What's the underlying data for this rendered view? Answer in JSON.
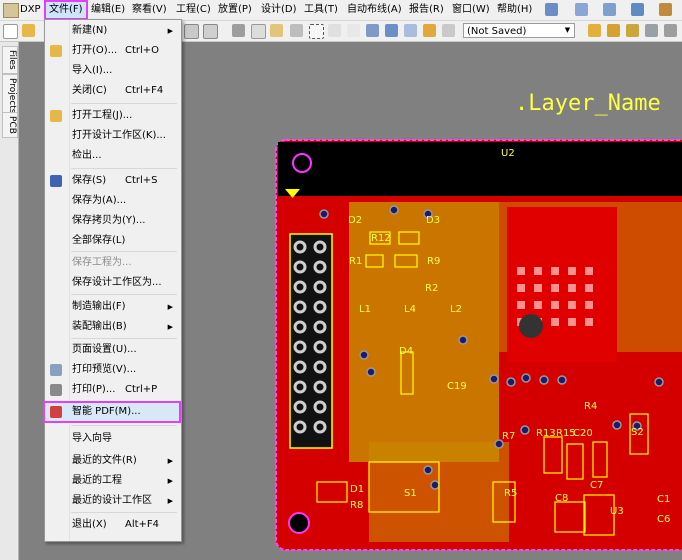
{
  "menubar": {
    "app": "DXP",
    "items": [
      "文件(F)",
      "编辑(E)",
      "察看(V)",
      "工程(C)",
      "放置(P)",
      "设计(D)",
      "工具(T)",
      "自动布线(A)",
      "报告(R)",
      "窗口(W)",
      "帮助(H)"
    ]
  },
  "toolbar": {
    "saved_state": "(Not Saved)"
  },
  "side_tabs": [
    "Files",
    "Projects",
    "PCB"
  ],
  "file_menu": {
    "items": [
      {
        "label": "新建(N)",
        "shortcut": "",
        "submenu": true,
        "disabled": false
      },
      {
        "label": "打开(O)...",
        "shortcut": "Ctrl+O",
        "submenu": false,
        "disabled": false
      },
      {
        "label": "导入(I)...",
        "shortcut": "",
        "submenu": false,
        "disabled": false
      },
      {
        "label": "关闭(C)",
        "shortcut": "Ctrl+F4",
        "submenu": false,
        "disabled": false
      },
      {
        "label": "打开工程(J)...",
        "shortcut": "",
        "submenu": false,
        "disabled": false
      },
      {
        "label": "打开设计工作区(K)...",
        "shortcut": "",
        "submenu": false,
        "disabled": false
      },
      {
        "label": "检出...",
        "shortcut": "",
        "submenu": false,
        "disabled": false
      },
      {
        "label": "保存(S)",
        "shortcut": "Ctrl+S",
        "submenu": false,
        "disabled": false
      },
      {
        "label": "保存为(A)...",
        "shortcut": "",
        "submenu": false,
        "disabled": false
      },
      {
        "label": "保存拷贝为(Y)...",
        "shortcut": "",
        "submenu": false,
        "disabled": false
      },
      {
        "label": "全部保存(L)",
        "shortcut": "",
        "submenu": false,
        "disabled": false
      },
      {
        "label": "保存工程为...",
        "shortcut": "",
        "submenu": false,
        "disabled": true
      },
      {
        "label": "保存设计工作区为...",
        "shortcut": "",
        "submenu": false,
        "disabled": false
      },
      {
        "label": "制造输出(F)",
        "shortcut": "",
        "submenu": true,
        "disabled": false
      },
      {
        "label": "装配输出(B)",
        "shortcut": "",
        "submenu": true,
        "disabled": false
      },
      {
        "label": "页面设置(U)...",
        "shortcut": "",
        "submenu": false,
        "disabled": false
      },
      {
        "label": "打印预览(V)...",
        "shortcut": "",
        "submenu": false,
        "disabled": false
      },
      {
        "label": "打印(P)...",
        "shortcut": "Ctrl+P",
        "submenu": false,
        "disabled": false
      },
      {
        "label": "智能 PDF(M)...",
        "shortcut": "",
        "submenu": false,
        "disabled": false
      },
      {
        "label": "导入向导",
        "shortcut": "",
        "submenu": false,
        "disabled": false
      },
      {
        "label": "最近的文件(R)",
        "shortcut": "",
        "submenu": true,
        "disabled": false
      },
      {
        "label": "最近的工程",
        "shortcut": "",
        "submenu": true,
        "disabled": false
      },
      {
        "label": "最近的设计工作区",
        "shortcut": "",
        "submenu": true,
        "disabled": false
      },
      {
        "label": "退出(X)",
        "shortcut": "Alt+F4",
        "submenu": false,
        "disabled": false
      }
    ]
  },
  "pcb": {
    "layer_name": ".Layer_Name",
    "designators": [
      "U2",
      "D2",
      "D3",
      "R12",
      "R1",
      "R9",
      "R2",
      "L1",
      "L4",
      "L2",
      "C19",
      "D4",
      "R4",
      "R7",
      "S2",
      "D1",
      "R8",
      "S1",
      "R5",
      "C8",
      "C7",
      "U3",
      "R13",
      "R15",
      "C20",
      "C1",
      "C6"
    ]
  }
}
